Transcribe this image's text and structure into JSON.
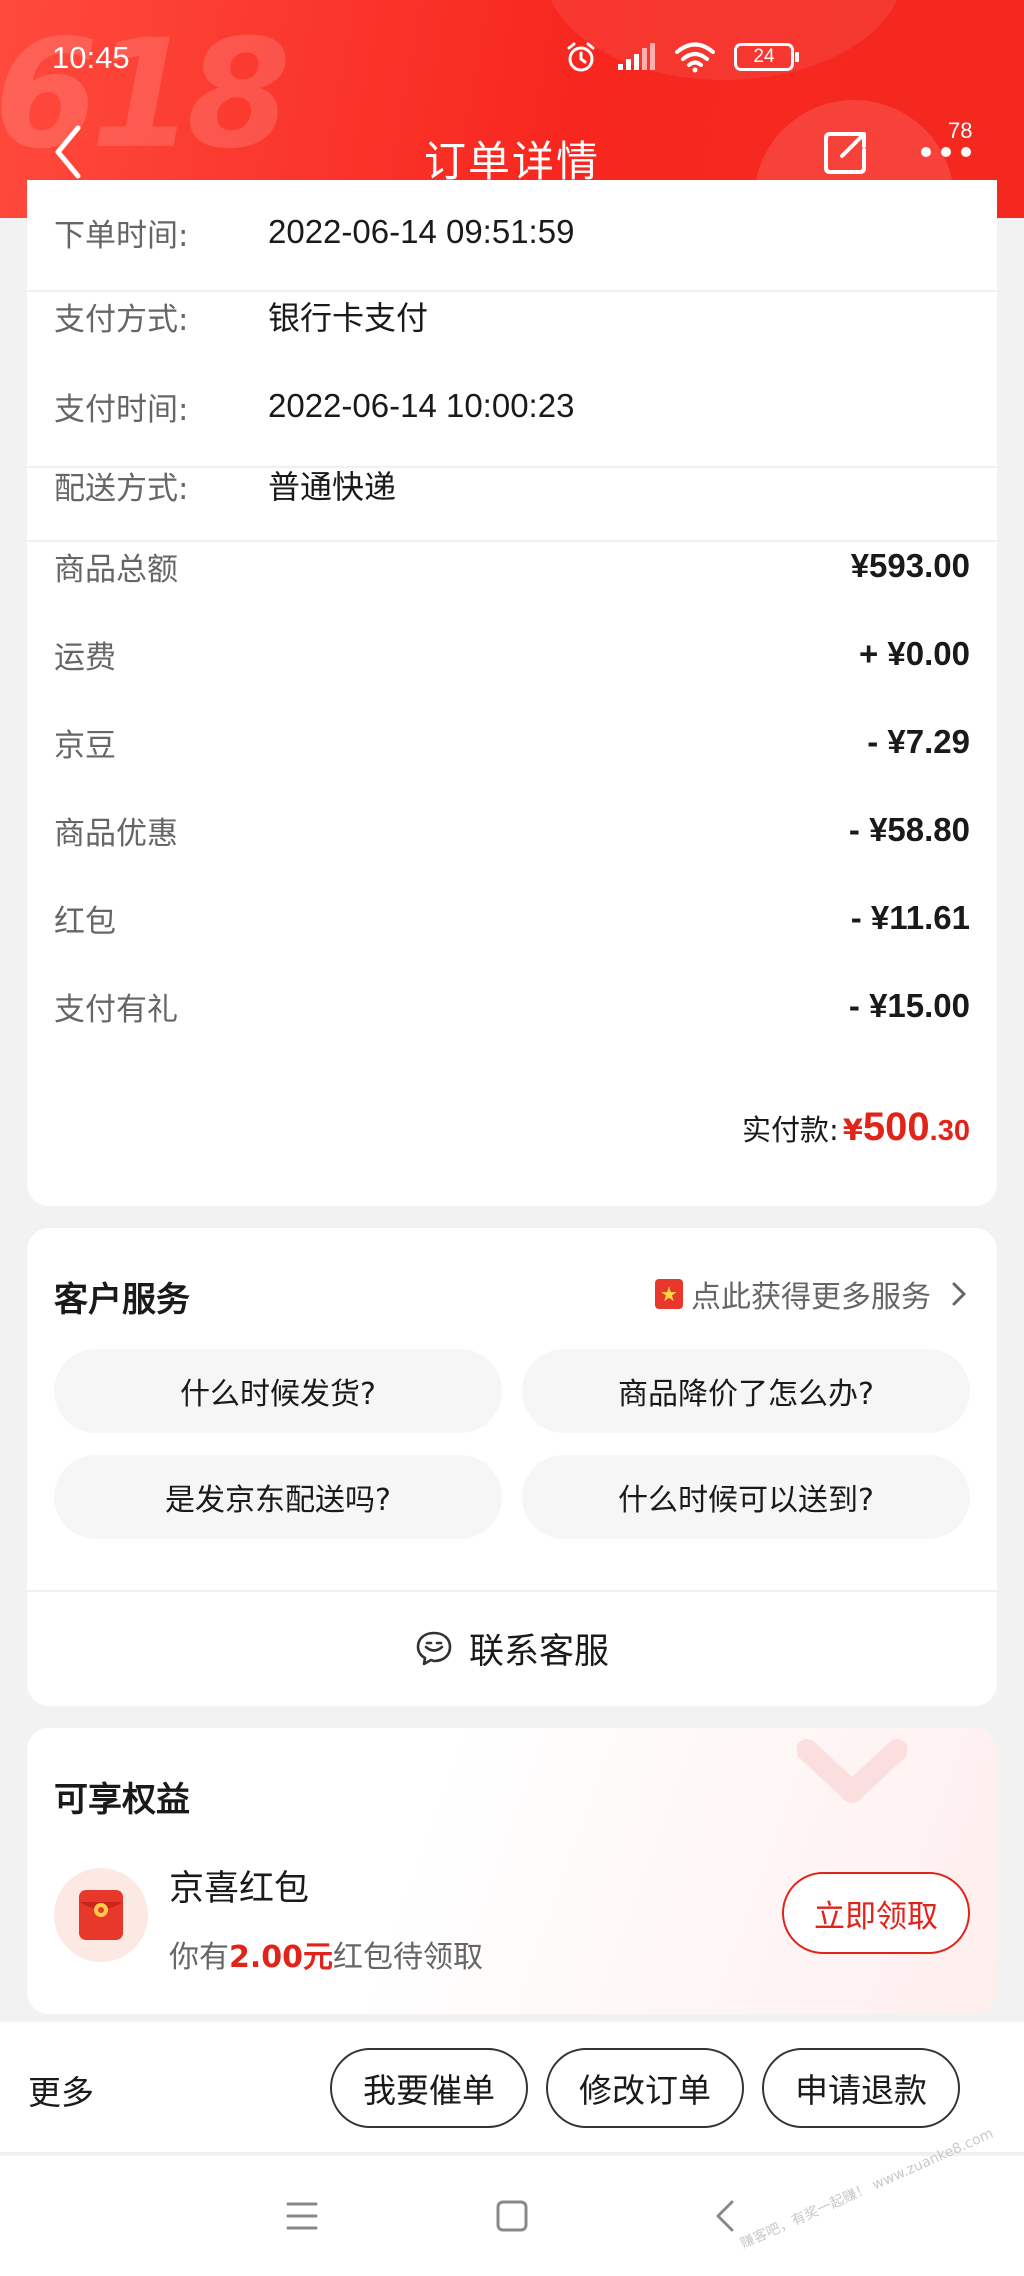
{
  "status_bar": {
    "time": "10:45",
    "battery": "24"
  },
  "header": {
    "title": "订单详情",
    "decor_text": "618",
    "more_badge": "78"
  },
  "order_info": {
    "rows": [
      {
        "label": "下单时间:",
        "value": "2022-06-14 09:51:59"
      },
      {
        "label": "支付方式:",
        "value": "银行卡支付"
      },
      {
        "label": "支付时间:",
        "value": "2022-06-14 10:00:23"
      },
      {
        "label": "配送方式:",
        "value": "普通快递"
      }
    ],
    "amounts": [
      {
        "label": "商品总额",
        "value": "¥593.00"
      },
      {
        "label": "运费",
        "value": "+ ¥0.00"
      },
      {
        "label": "京豆",
        "value": "- ¥7.29"
      },
      {
        "label": "商品优惠",
        "value": "- ¥58.80"
      },
      {
        "label": "红包",
        "value": "- ¥11.61"
      },
      {
        "label": "支付有礼",
        "value": "- ¥15.00"
      }
    ],
    "total": {
      "label": "实付款:",
      "currency": "¥",
      "integer": "500",
      "decimal": ".30"
    }
  },
  "customer_service": {
    "title": "客户服务",
    "more_link": "点此获得更多服务",
    "questions": [
      "什么时候发货?",
      "商品降价了怎么办?",
      "是发京东配送吗?",
      "什么时候可以送到?"
    ],
    "contact": "联系客服"
  },
  "benefits": {
    "title": "可享权益",
    "item_title": "京喜红包",
    "desc_prefix": "你有",
    "desc_amount": "2.00元",
    "desc_suffix": "红包待领取",
    "claim_button": "立即领取"
  },
  "action_bar": {
    "more": "更多",
    "buttons": [
      "我要催单",
      "修改订单",
      "申请退款"
    ]
  },
  "watermark": "赚客吧，有奖一起赚！ www.zuanke8.com",
  "colors": {
    "brand_red": "#f4281f",
    "price_red": "#e2231a"
  }
}
